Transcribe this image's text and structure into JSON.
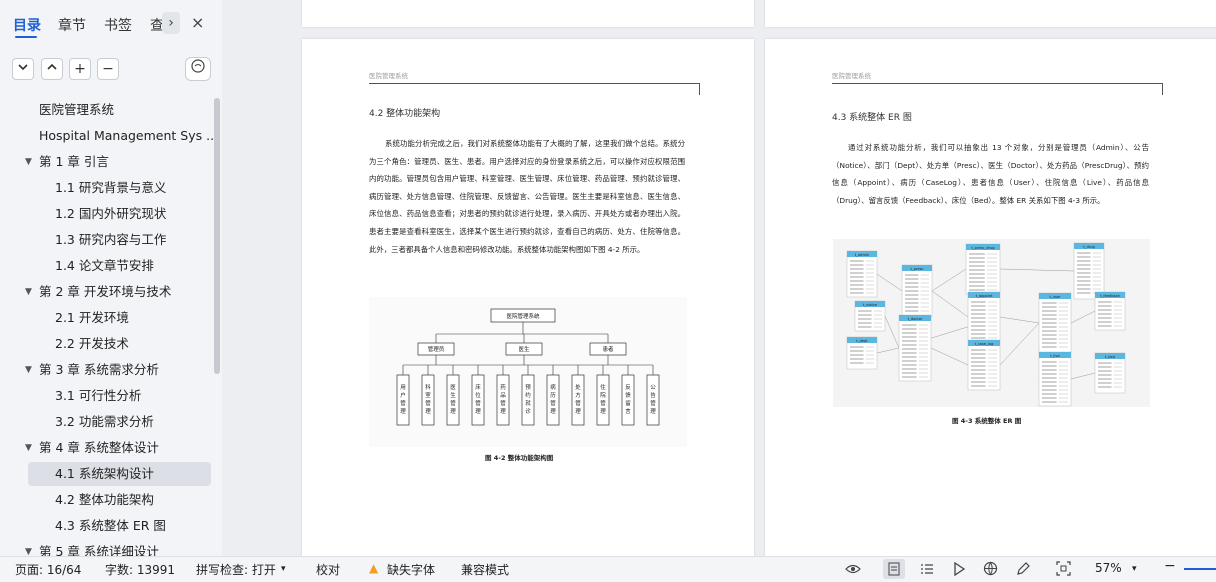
{
  "sidebar": {
    "tabs": [
      {
        "label": "目录"
      },
      {
        "label": "章节"
      },
      {
        "label": "书签"
      },
      {
        "label": "查"
      }
    ],
    "more_glyph": "›",
    "close_glyph": "×",
    "toolbar": {
      "collapse_glyph": "⌄",
      "expand_glyph": "⌃",
      "add_glyph": "+",
      "remove_glyph": "−"
    },
    "toc": [
      {
        "label": "医院管理系统",
        "level": 0
      },
      {
        "label": "Hospital Management Sys ...",
        "level": 0
      },
      {
        "label": "第 1 章  引言",
        "level": 1
      },
      {
        "label": "1.1  研究背景与意义",
        "level": 2
      },
      {
        "label": "1.2  国内外研究现状",
        "level": 2
      },
      {
        "label": "1.3  研究内容与工作",
        "level": 2
      },
      {
        "label": "1.4  论文章节安排",
        "level": 2
      },
      {
        "label": "第 2 章  开发环境与技术",
        "level": 1
      },
      {
        "label": "2.1  开发环境",
        "level": 2
      },
      {
        "label": "2.2  开发技术",
        "level": 2
      },
      {
        "label": "第 3 章  系统需求分析",
        "level": 1
      },
      {
        "label": "3.1  可行性分析",
        "level": 2
      },
      {
        "label": "3.2  功能需求分析",
        "level": 2
      },
      {
        "label": "第 4 章  系统整体设计",
        "level": 1
      },
      {
        "label": "4.1  系统架构设计",
        "level": 2,
        "selected": true
      },
      {
        "label": "4.2  整体功能架构",
        "level": 2
      },
      {
        "label": "4.3  系统整体 ER 图",
        "level": 2
      },
      {
        "label": "第 5 章  系统详细设计",
        "level": 1
      }
    ]
  },
  "left_page": {
    "running_header": "医院管理系统",
    "section_title": "4.2  整体功能架构",
    "paragraph": "系统功能分析完成之后，我们对系统整体功能有了大概的了解，这里我们做个总结。系统分为三个角色：管理员、医生、患者。用户选择对应的身份登录系统之后，可以操作对应权限范围内的功能。管理员包含用户管理、科室管理、医生管理、床位管理、药品管理、预约就诊管理、病历管理、处方信息管理、住院管理、反馈留言、公告管理。医生主要是科室信息、医生信息、床位信息、药品信息查看；对患者的预约就诊进行处理，录入病历、开具处方或者办理出入院。患者主要是查看科室医生，选择某个医生进行预约就诊，查看自己的病历、处方、住院等信息。此外，三者都具备个人信息和密码修改功能。系统整体功能架构图如下图 4-2 所示。",
    "diagram": {
      "root": "医院管理系统",
      "roles": [
        "管理员",
        "医生",
        "患者"
      ],
      "leaves": [
        "用户管理",
        "科室管理",
        "医生管理",
        "床位管理",
        "药品管理",
        "预约就诊",
        "病历管理",
        "处方管理",
        "住院管理",
        "反馈留言",
        "公告管理"
      ]
    },
    "caption": "图 4-2  整体功能架构图"
  },
  "right_page": {
    "running_header": "医院管理系统",
    "section_title": "4.3  系统整体 ER 图",
    "paragraph": "通过对系统功能分析，我们可以抽象出 13 个对象，分别是管理员（Admin）、公告（Notice）、部门（Dept）、处方单（Presc）、医生（Doctor）、处方药品（PrescDrug）、预约信息（Appoint）、病历（CaseLog）、患者信息（User）、住院信息（Live）、药品信息（Drug）、留言反馈（Feedback）、床位（Bed）。整体 ER 关系如下图 4-3 所示。",
    "er_tables": [
      "t_admin",
      "t_presc",
      "t_presc_drug",
      "t_drug",
      "t_notice",
      "t_appoint",
      "t_user",
      "t_feedback",
      "t_dept",
      "t_doctor",
      "t_case_log",
      "t_live",
      "t_bed"
    ],
    "caption": "图 4-3  系统整体 ER 图"
  },
  "statusbar": {
    "page": "页面: 16/64",
    "words": "字数: 13991",
    "spell": "拼写检查: 打开",
    "proofread": "校对",
    "missing_fonts": "缺失字体",
    "compat_mode": "兼容模式",
    "zoom": "57%"
  },
  "colors": {
    "accent": "#1f5fd6",
    "er_header": "#5bb7e0",
    "warning": "#f0a020"
  }
}
